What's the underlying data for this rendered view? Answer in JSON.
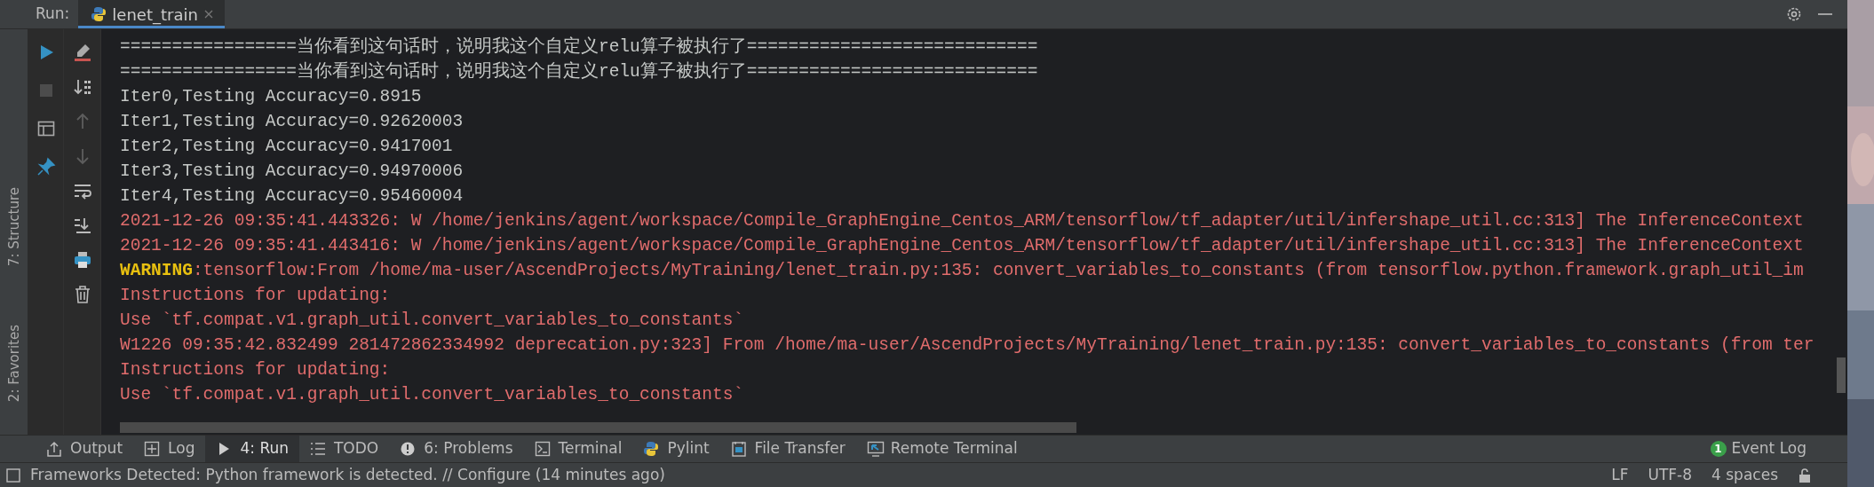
{
  "header": {
    "label": "Run:",
    "tabs": [
      {
        "label": "lenet_train",
        "selected": true
      }
    ]
  },
  "side_tabs": [
    {
      "label": "7: Structure"
    },
    {
      "label": "2: Favorites"
    }
  ],
  "run_tools": [
    {
      "kind": "play",
      "disabled": false
    },
    {
      "kind": "stop",
      "disabled": true
    },
    {
      "kind": "layout",
      "disabled": false
    },
    {
      "kind": "pin",
      "disabled": false
    }
  ],
  "console_tools": [
    {
      "kind": "clear",
      "disabled": false
    },
    {
      "kind": "sort",
      "disabled": false
    },
    {
      "kind": "up",
      "disabled": true
    },
    {
      "kind": "down",
      "disabled": true
    },
    {
      "kind": "wrap",
      "disabled": false
    },
    {
      "kind": "scroll-end",
      "disabled": false
    },
    {
      "kind": "print",
      "disabled": false
    },
    {
      "kind": "trash",
      "disabled": false
    }
  ],
  "console": [
    {
      "kind": "normal",
      "text": "=================当你看到这句话时，说明我这个自定义relu算子被执行了============================"
    },
    {
      "kind": "normal",
      "text": "=================当你看到这句话时，说明我这个自定义relu算子被执行了============================"
    },
    {
      "kind": "normal",
      "text": "Iter0,Testing Accuracy=0.8915"
    },
    {
      "kind": "normal",
      "text": "Iter1,Testing Accuracy=0.92620003"
    },
    {
      "kind": "normal",
      "text": "Iter2,Testing Accuracy=0.9417001"
    },
    {
      "kind": "normal",
      "text": "Iter3,Testing Accuracy=0.94970006"
    },
    {
      "kind": "normal",
      "text": "Iter4,Testing Accuracy=0.95460004"
    },
    {
      "kind": "error",
      "text": "2021-12-26 09:35:41.443326: W /home/jenkins/agent/workspace/Compile_GraphEngine_Centos_ARM/tensorflow/tf_adapter/util/infershape_util.cc:313] The InferenceContext"
    },
    {
      "kind": "error",
      "text": "2021-12-26 09:35:41.443416: W /home/jenkins/agent/workspace/Compile_GraphEngine_Centos_ARM/tensorflow/tf_adapter/util/infershape_util.cc:313] The InferenceContext"
    },
    {
      "kind": "warning",
      "prefix": "WARNING",
      "text": ":tensorflow:From /home/ma-user/AscendProjects/MyTraining/lenet_train.py:135: convert_variables_to_constants (from tensorflow.python.framework.graph_util_im"
    },
    {
      "kind": "error",
      "text": "Instructions for updating:"
    },
    {
      "kind": "error",
      "text": "Use `tf.compat.v1.graph_util.convert_variables_to_constants`"
    },
    {
      "kind": "error",
      "text": "W1226 09:35:42.832499 281472862334992 deprecation.py:323] From /home/ma-user/AscendProjects/MyTraining/lenet_train.py:135: convert_variables_to_constants (from ter"
    },
    {
      "kind": "error",
      "text": "Instructions for updating:"
    },
    {
      "kind": "error",
      "text": "Use `tf.compat.v1.graph_util.convert_variables_to_constants`"
    }
  ],
  "tool_windows": [
    {
      "kind": "output",
      "label": "Output",
      "selected": false
    },
    {
      "kind": "log",
      "label": "Log",
      "selected": false
    },
    {
      "kind": "run",
      "label": "4: Run",
      "selected": true
    },
    {
      "kind": "todo",
      "label": "TODO",
      "selected": false
    },
    {
      "kind": "problems",
      "label": "6: Problems",
      "selected": false
    },
    {
      "kind": "terminal",
      "label": "Terminal",
      "selected": false
    },
    {
      "kind": "pylint",
      "label": "Pylint",
      "selected": false
    },
    {
      "kind": "transfer",
      "label": "File Transfer",
      "selected": false
    },
    {
      "kind": "remote",
      "label": "Remote Terminal",
      "selected": false
    }
  ],
  "event_log": {
    "label": "Event Log",
    "count": "1"
  },
  "status_bar": {
    "message": "Frameworks Detected: Python framework is detected. // Configure (14 minutes ago)",
    "items": [
      "LF",
      "UTF-8",
      "4 spaces"
    ]
  }
}
